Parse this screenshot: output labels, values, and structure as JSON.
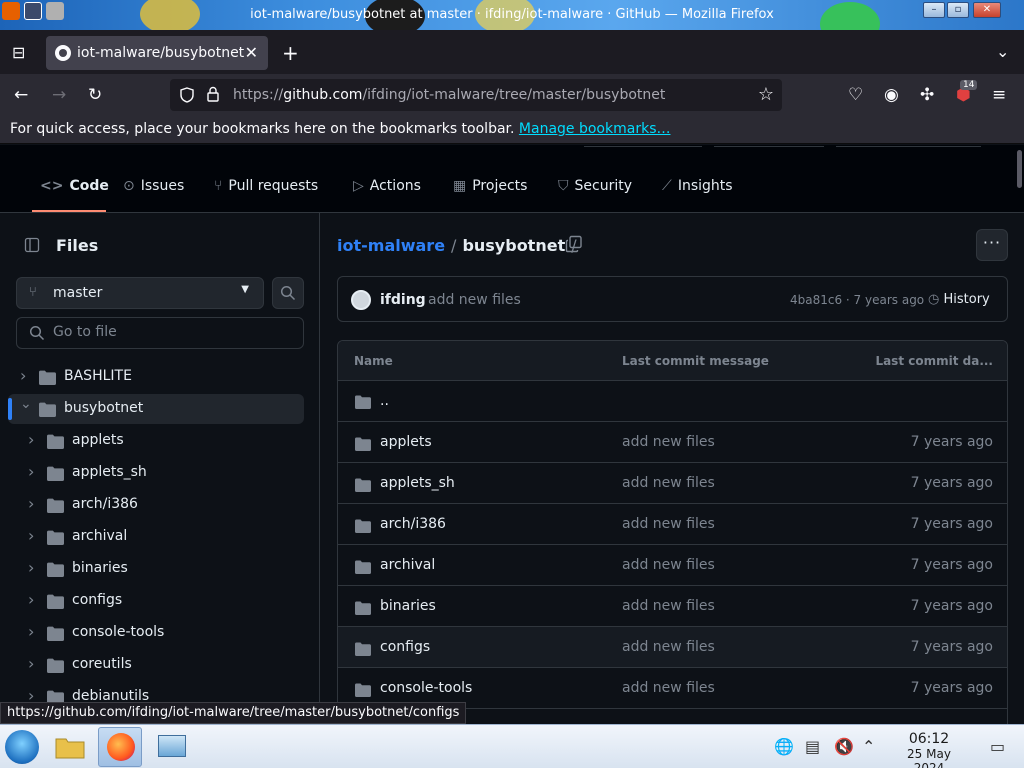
{
  "window": {
    "title": "iot-malware/busybotnet at master · ifding/iot-malware · GitHub — Mozilla Firefox"
  },
  "browser": {
    "tab_title": "iot-malware/busybotnet",
    "url_prefix": "https://",
    "url_domain": "github.com",
    "url_path": "/ifding/iot-malware/tree/master/busybotnet",
    "extension_badge": "14",
    "bookmarks_message": "For quick access, place your bookmarks here on the bookmarks toolbar.",
    "bookmarks_link": "Manage bookmarks…",
    "status_url": "https://github.com/ifding/iot-malware/tree/master/busybotnet/configs"
  },
  "repo_nav": {
    "tabs": [
      {
        "label": "Code",
        "icon": "code-icon"
      },
      {
        "label": "Issues",
        "icon": "issue-icon"
      },
      {
        "label": "Pull requests",
        "icon": "pull-request-icon"
      },
      {
        "label": "Actions",
        "icon": "play-icon"
      },
      {
        "label": "Projects",
        "icon": "table-icon"
      },
      {
        "label": "Security",
        "icon": "shield-icon"
      },
      {
        "label": "Insights",
        "icon": "graph-icon"
      }
    ],
    "active_tab": "Code"
  },
  "sidebar": {
    "title": "Files",
    "branch": "master",
    "goto_placeholder": "Go to file",
    "tree": [
      {
        "name": "BASHLITE",
        "depth": 0,
        "expanded": false,
        "selected": false
      },
      {
        "name": "busybotnet",
        "depth": 0,
        "expanded": true,
        "selected": true
      },
      {
        "name": "applets",
        "depth": 1,
        "expanded": false,
        "selected": false
      },
      {
        "name": "applets_sh",
        "depth": 1,
        "expanded": false,
        "selected": false
      },
      {
        "name": "arch/i386",
        "depth": 1,
        "expanded": false,
        "selected": false
      },
      {
        "name": "archival",
        "depth": 1,
        "expanded": false,
        "selected": false
      },
      {
        "name": "binaries",
        "depth": 1,
        "expanded": false,
        "selected": false
      },
      {
        "name": "configs",
        "depth": 1,
        "expanded": false,
        "selected": false
      },
      {
        "name": "console-tools",
        "depth": 1,
        "expanded": false,
        "selected": false
      },
      {
        "name": "coreutils",
        "depth": 1,
        "expanded": false,
        "selected": false
      },
      {
        "name": "debianutils",
        "depth": 1,
        "expanded": false,
        "selected": false
      }
    ]
  },
  "main": {
    "breadcrumb_repo": "iot-malware",
    "breadcrumb_sep": "/",
    "breadcrumb_current": "busybotnet",
    "commit": {
      "author": "ifding",
      "message": "add new files",
      "meta": "4ba81c6 · 7 years ago",
      "history_label": "History"
    },
    "table": {
      "headers": {
        "name": "Name",
        "message": "Last commit message",
        "date": "Last commit da..."
      },
      "parent_row": "..",
      "rows": [
        {
          "name": "applets",
          "message": "add new files",
          "date": "7 years ago"
        },
        {
          "name": "applets_sh",
          "message": "add new files",
          "date": "7 years ago"
        },
        {
          "name": "arch/i386",
          "message": "add new files",
          "date": "7 years ago"
        },
        {
          "name": "archival",
          "message": "add new files",
          "date": "7 years ago"
        },
        {
          "name": "binaries",
          "message": "add new files",
          "date": "7 years ago"
        },
        {
          "name": "configs",
          "message": "add new files",
          "date": "7 years ago"
        },
        {
          "name": "console-tools",
          "message": "add new files",
          "date": "7 years ago"
        }
      ],
      "hovered_row": "configs"
    }
  },
  "taskbar": {
    "time": "06:12",
    "date": "25 May 2024"
  },
  "colors": {
    "accent_link": "#2f81f7",
    "nav_underline": "#fd8c73",
    "folder": "#7d8590",
    "firefox_link": "#00ddff"
  }
}
